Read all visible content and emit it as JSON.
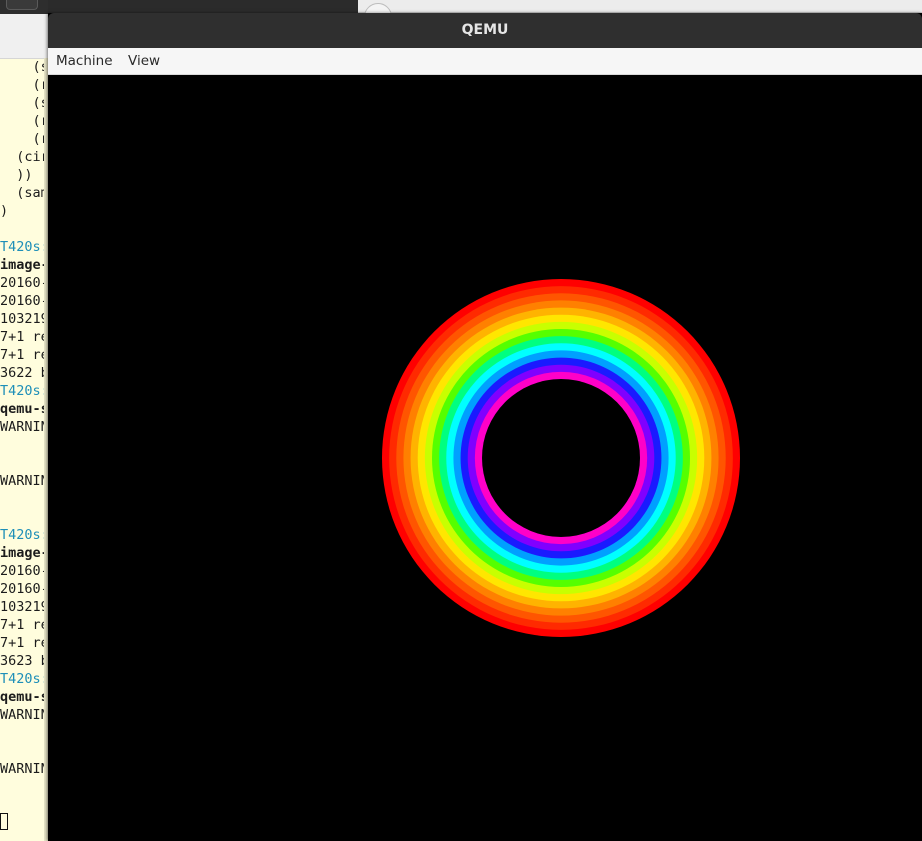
{
  "terminal": {
    "lines": [
      {
        "text": "    (s",
        "style": "normal"
      },
      {
        "text": "    (r",
        "style": "normal"
      },
      {
        "text": "    (s",
        "style": "normal"
      },
      {
        "text": "    (r",
        "style": "normal"
      },
      {
        "text": "    (r",
        "style": "normal"
      },
      {
        "text": "  (cir",
        "style": "normal"
      },
      {
        "text": "  ))",
        "style": "normal"
      },
      {
        "text": "  (sam",
        "style": "normal"
      },
      {
        "text": ")",
        "style": "normal"
      },
      {
        "text": "",
        "style": "normal"
      },
      {
        "text": "T420s:",
        "style": "prompt"
      },
      {
        "text": "image-",
        "style": "bold"
      },
      {
        "text": "20160-",
        "style": "normal"
      },
      {
        "text": "20160-",
        "style": "normal"
      },
      {
        "text": "103219",
        "style": "normal"
      },
      {
        "text": "7+1 re",
        "style": "normal"
      },
      {
        "text": "7+1 re",
        "style": "normal"
      },
      {
        "text": "3622 b",
        "style": "normal"
      },
      {
        "text": "T420s:",
        "style": "prompt"
      },
      {
        "text": "qemu-s",
        "style": "bold"
      },
      {
        "text": "WARNIN",
        "style": "normal"
      },
      {
        "text": "",
        "style": "normal"
      },
      {
        "text": "",
        "style": "normal"
      },
      {
        "text": "WARNIN",
        "style": "normal"
      },
      {
        "text": "",
        "style": "normal"
      },
      {
        "text": "",
        "style": "normal"
      },
      {
        "text": "T420s:",
        "style": "prompt"
      },
      {
        "text": "image-",
        "style": "bold"
      },
      {
        "text": "20160-",
        "style": "normal"
      },
      {
        "text": "20160-",
        "style": "normal"
      },
      {
        "text": "103219",
        "style": "normal"
      },
      {
        "text": "7+1 re",
        "style": "normal"
      },
      {
        "text": "7+1 re",
        "style": "normal"
      },
      {
        "text": "3623 b",
        "style": "normal"
      },
      {
        "text": "T420s:",
        "style": "prompt"
      },
      {
        "text": "qemu-s",
        "style": "bold"
      },
      {
        "text": "WARNIN",
        "style": "normal"
      },
      {
        "text": "",
        "style": "normal"
      },
      {
        "text": "",
        "style": "normal"
      },
      {
        "text": "WARNIN",
        "style": "normal"
      }
    ]
  },
  "qemu": {
    "title": "QEMU",
    "menu": {
      "machine": "Machine",
      "view": "View"
    },
    "ring_colors": [
      "#ff0000",
      "#ff2a00",
      "#ff5500",
      "#ff8000",
      "#ffb300",
      "#ffe600",
      "#c8ff00",
      "#55ff00",
      "#00ff80",
      "#00ffff",
      "#00a0ff",
      "#1a1aff",
      "#8000ff",
      "#ff00c8"
    ]
  }
}
